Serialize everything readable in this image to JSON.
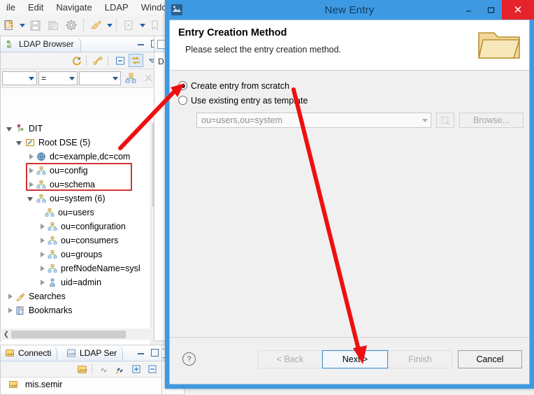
{
  "workbench": {
    "menubar": [
      {
        "label": "ile",
        "icon": "menu-file"
      },
      {
        "label": "Edit",
        "icon": "menu-edit"
      },
      {
        "label": "Navigate",
        "icon": "menu-navigate"
      },
      {
        "label": "LDAP",
        "icon": "menu-ldap"
      },
      {
        "label": "Window",
        "icon": "menu-window"
      }
    ],
    "toolbar_icons": [
      "new-entry-icon",
      "dropdown-caret-icon",
      "save-icon",
      "save-all-icon",
      "properties-gear-icon",
      "separator",
      "paste-ldif-icon",
      "dropdown-caret-icon",
      "separator",
      "new-search-icon",
      "dropdown-caret-icon",
      "new-bookmark-icon"
    ],
    "left_view": {
      "tab_label": "LDAP Browser",
      "tab_icon": "ldap-browser-icon",
      "minimize_icon": "minimize-icon",
      "maximize_icon": "maximize-icon",
      "toolbar_icons": [
        "refresh-icon",
        "separator",
        "unfold-icon",
        "separator",
        "collapse-all-icon",
        "link-with-editor-icon",
        "view-menu-icon"
      ],
      "filter": {
        "attribute_value": "",
        "operator": "=",
        "value": "",
        "quick_filter_icon": "quick-filter-icon",
        "clear-filter-icon": "clear-filter-icon"
      },
      "tree": [
        {
          "label": "DIT",
          "indent": 0,
          "twisty": "open",
          "icon": "dit-icon"
        },
        {
          "label": "Root DSE (5)",
          "indent": 1,
          "twisty": "open",
          "icon": "root-dse-icon"
        },
        {
          "label": "dc=example,dc=com",
          "indent": 2,
          "twisty": "closed",
          "icon": "globe-icon"
        },
        {
          "label": "ou=config",
          "indent": 2,
          "twisty": "closed",
          "icon": "org-unit-icon"
        },
        {
          "label": "ou=schema",
          "indent": 2,
          "twisty": "closed",
          "icon": "org-unit-icon"
        },
        {
          "label": "ou=system (6)",
          "indent": 2,
          "twisty": "open",
          "icon": "org-unit-icon"
        },
        {
          "label": "ou=users",
          "indent": 3,
          "twisty": "none",
          "icon": "org-unit-icon"
        },
        {
          "label": "ou=configuration",
          "indent": 3,
          "twisty": "closed",
          "icon": "org-unit-icon"
        },
        {
          "label": "ou=consumers",
          "indent": 3,
          "twisty": "closed",
          "icon": "org-unit-icon"
        },
        {
          "label": "ou=groups",
          "indent": 3,
          "twisty": "closed",
          "icon": "org-unit-icon"
        },
        {
          "label": "prefNodeName=sysl",
          "indent": 3,
          "twisty": "closed",
          "icon": "org-unit-icon"
        },
        {
          "label": "uid=admin",
          "indent": 3,
          "twisty": "closed",
          "icon": "person-icon"
        },
        {
          "label": "Searches",
          "indent": 0,
          "twisty": "closed",
          "icon": "searches-icon"
        },
        {
          "label": "Bookmarks",
          "indent": 0,
          "twisty": "closed",
          "icon": "bookmarks-icon"
        }
      ]
    },
    "bottom_view": {
      "tabs": [
        {
          "label": "Connecti",
          "icon": "connections-icon"
        },
        {
          "label": "LDAP Ser",
          "icon": "ldap-servers-icon"
        }
      ],
      "minimize_icon": "minimize-icon",
      "maximize_icon": "maximize-icon",
      "toolbar_icons": [
        "new-connection-icon",
        "separator",
        "disconnect-icon",
        "connect-icon",
        "expand-icon",
        "collapse-icon"
      ],
      "rows": [
        {
          "label": "mis.semir",
          "icon": "connection-icon"
        }
      ]
    }
  },
  "dialog": {
    "title": "New Entry",
    "title_icon": "app-icon",
    "window_buttons": {
      "minimize": "minimize-icon",
      "maximize": "maximize-icon",
      "close": "close-icon",
      "close_glyph": "✕"
    },
    "header": {
      "title": "Entry Creation Method",
      "subtitle": "Please select the entry creation method.",
      "banner_icon": "folder-icon"
    },
    "options": [
      {
        "label": "Create entry from scratch",
        "selected": true
      },
      {
        "label": "Use existing entry as template",
        "selected": false
      }
    ],
    "template_combo": {
      "value": "ou=users,ou=system",
      "enabled": false,
      "picker_icon": "entry-picker-icon",
      "browse_label": "Browse..."
    },
    "footer": {
      "help_icon": "help-icon",
      "help_glyph": "?",
      "buttons": [
        {
          "label": "< Back",
          "state": "disabled"
        },
        {
          "label": "Next >",
          "state": "default-focused"
        },
        {
          "label": "Finish",
          "state": "disabled"
        },
        {
          "label": "Cancel",
          "state": "enabled"
        }
      ]
    }
  },
  "annotations": {
    "highlight_box": {
      "color": "#cc0000",
      "target": "ou=system-and-ou=users-tree-rows"
    },
    "arrows": [
      {
        "color": "#ee1111",
        "points_to": "create-entry-from-scratch-radio"
      },
      {
        "color": "#ee1111",
        "points_to": "next-button"
      }
    ]
  },
  "colors": {
    "dialog_titlebar": "#3d9ae2",
    "close_button": "#e6222a",
    "annotation_red": "#ee1111",
    "highlight_red": "#cc0000",
    "focus_blue": "#4a90c8"
  }
}
